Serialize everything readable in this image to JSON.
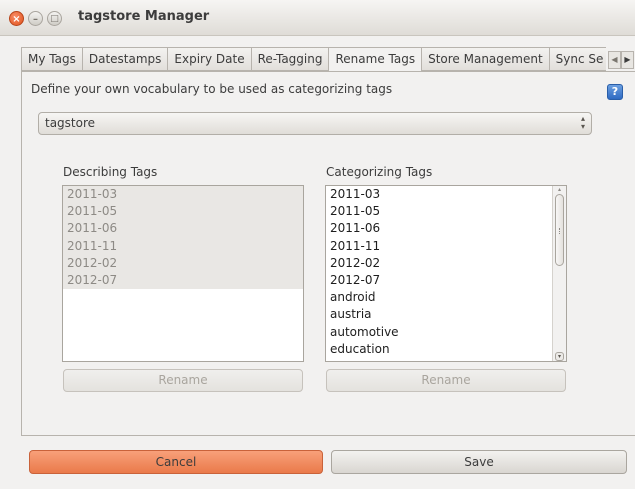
{
  "window": {
    "title": "tagstore Manager"
  },
  "tabs": [
    {
      "label": "My Tags"
    },
    {
      "label": "Datestamps"
    },
    {
      "label": "Expiry Date"
    },
    {
      "label": "Re-Tagging"
    },
    {
      "label": "Rename Tags"
    },
    {
      "label": "Store Management"
    },
    {
      "label": "Sync Se"
    }
  ],
  "active_tab": "Rename Tags",
  "panel": {
    "description": "Define your own vocabulary to be used as categorizing tags",
    "store_select": {
      "value": "tagstore"
    },
    "describing": {
      "label": "Describing Tags",
      "items": [
        "2011-03",
        "2011-05",
        "2011-06",
        "2011-11",
        "2012-02",
        "2012-07"
      ],
      "rename_label": "Rename"
    },
    "categorizing": {
      "label": "Categorizing Tags",
      "items": [
        "2011-03",
        "2011-05",
        "2011-06",
        "2011-11",
        "2012-02",
        "2012-07",
        "android",
        "austria",
        "automotive",
        "education"
      ],
      "rename_label": "Rename"
    }
  },
  "footer": {
    "cancel_label": "Cancel",
    "save_label": "Save"
  },
  "icons": {
    "close": "close-icon",
    "minimize": "minimize-icon",
    "maximize": "maximize-icon",
    "help": "help-icon"
  },
  "colors": {
    "accent": "#ea7a4a",
    "help": "#2f6ac2"
  }
}
